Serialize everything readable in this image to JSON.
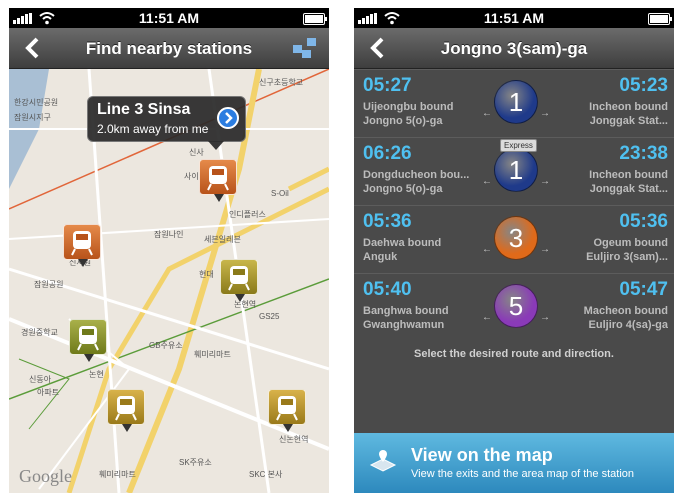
{
  "status": {
    "time": "11:51 AM"
  },
  "left": {
    "title": "Find nearby stations",
    "callout": {
      "title": "Line 3 Sinsa",
      "subtitle": "2.0km away from me"
    },
    "map_brand": "Google",
    "map_labels": [
      "신구초등학교",
      "잠원시지구",
      "한강시민공원",
      "신사",
      "사이드호텔",
      "S-Oil",
      "인디플러스",
      "세븐일레븐",
      "잠원나인",
      "신사원",
      "잠원공원",
      "현대",
      "논현역",
      "GS25",
      "경원중학교",
      "신동아",
      "아파트",
      "논현",
      "GB주유소",
      "훼미리마트",
      "훼미리마트",
      "SK주유소",
      "SKC 본사",
      "신논현역"
    ]
  },
  "right": {
    "title": "Jongno 3(sam)-ga",
    "rows": [
      {
        "left_time": "05:27",
        "right_time": "05:23",
        "left_dir": "Uijeongbu bound",
        "left_sub": "Jongno 5(o)-ga",
        "right_dir": "Incheon bound",
        "right_sub": "Jonggak Stat...",
        "line": "1",
        "color": "#1f3a8a",
        "express": ""
      },
      {
        "left_time": "06:26",
        "right_time": "23:38",
        "left_dir": "Dongducheon bou...",
        "left_sub": "Jongno 5(o)-ga",
        "right_dir": "Incheon bound",
        "right_sub": "Jonggak Stat...",
        "line": "1",
        "color": "#1f3a8a",
        "express": "Express"
      },
      {
        "left_time": "05:36",
        "right_time": "05:36",
        "left_dir": "Daehwa bound",
        "left_sub": "Anguk",
        "right_dir": "Ogeum bound",
        "right_sub": "Euljiro 3(sam)...",
        "line": "3",
        "color": "#e06a1a",
        "express": ""
      },
      {
        "left_time": "05:40",
        "right_time": "05:47",
        "left_dir": "Banghwa bound",
        "left_sub": "Gwanghwamun",
        "right_dir": "Macheon bound",
        "right_sub": "Euljiro 4(sa)-ga",
        "line": "5",
        "color": "#8a3ab8",
        "express": ""
      }
    ],
    "hint": "Select the desired route and direction.",
    "button": {
      "title": "View on the map",
      "subtitle": "View the exits and the area map of the station"
    }
  }
}
